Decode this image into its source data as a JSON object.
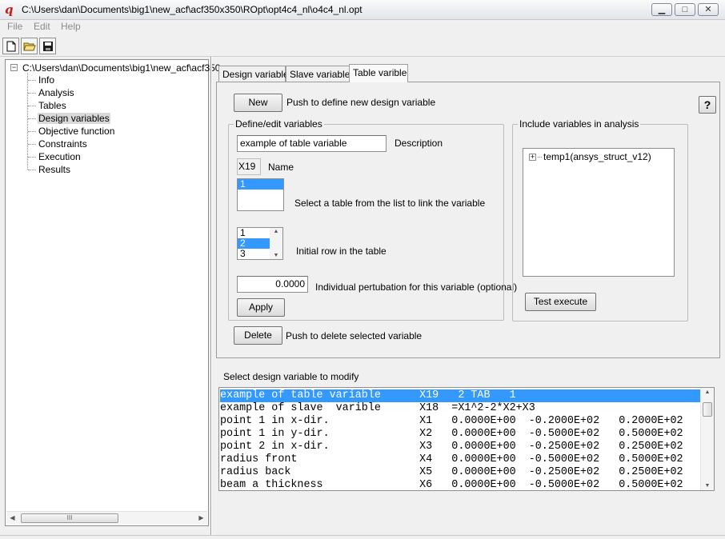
{
  "window": {
    "title": "C:\\Users\\dan\\Documents\\big1\\new_acf\\acf350x350\\ROpt\\opt4c4_nl\\o4c4_nl.opt",
    "app_icon_glyph": "q",
    "minimize": "▁",
    "maximize": "□",
    "close": "✕"
  },
  "menu": {
    "file": "File",
    "edit": "Edit",
    "help": "Help"
  },
  "tree": {
    "root": "C:\\Users\\dan\\Documents\\big1\\new_acf\\acf350",
    "items": [
      "Info",
      "Analysis",
      "Tables",
      "Design variables",
      "Objective function",
      "Constraints",
      "Execution",
      "Results"
    ],
    "collapse_glyph": "−",
    "scroll_left": "◀",
    "scroll_right": "▶",
    "thumb_grip": "III"
  },
  "tabs": [
    "Design variable",
    "Slave variable",
    "Table varible"
  ],
  "panel": {
    "new_button": "New",
    "new_hint": "Push to define new design variable",
    "help_button": "?",
    "define_group": "Define/edit variables",
    "description_value": "example of table variable",
    "description_label": "Description",
    "name_value": "X19",
    "name_label": "Name",
    "tables": [
      "1"
    ],
    "table_hint": "Select a table from the list to link the variable",
    "rows": [
      "1",
      "2",
      "3"
    ],
    "row_hint": "Initial row in the table",
    "spin_up": "▲",
    "spin_down": "▼",
    "perturbation_value": "0.0000",
    "perturbation_label": "Individual pertubation for this variable (optional)",
    "apply_button": "Apply",
    "include_group": "Include variables in analysis",
    "include_item": "temp1(ansys_struct_v12)",
    "test_button": "Test execute",
    "delete_button": "Delete",
    "delete_hint": "Push to delete selected variable"
  },
  "variables": {
    "label": "Select design variable to modify",
    "rows": [
      "example of table variable      X19   2 TAB   1",
      "example of slave  varible      X18  =X1^2-2*X2+X3",
      "point 1 in x-dir.              X1   0.0000E+00  -0.2000E+02   0.2000E+02",
      "point 1 in y-dir.              X2   0.0000E+00  -0.5000E+02   0.5000E+02",
      "point 2 in x-dir.              X3   0.0000E+00  -0.2500E+02   0.2500E+02",
      "radius front                   X4   0.0000E+00  -0.5000E+02   0.5000E+02",
      "radius back                    X5   0.0000E+00  -0.2500E+02   0.2500E+02",
      "beam a thickness               X6   0.0000E+00  -0.5000E+02   0.5000E+02"
    ],
    "scroll_up": "▲",
    "scroll_down": "▼",
    "selected_index": 0
  },
  "colors": {
    "selection": "#3399ff",
    "app_icon": "#c21f1f"
  }
}
